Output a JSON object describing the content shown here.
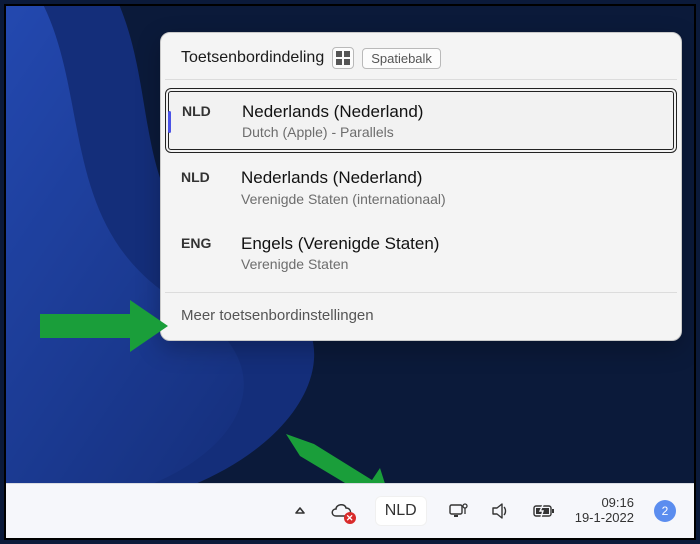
{
  "flyout": {
    "title": "Toetsenbordindeling",
    "shortcut_keys": {
      "win": "⊞",
      "spatie": "Spatiebalk"
    },
    "items": [
      {
        "code": "NLD",
        "lang": "Nederlands (Nederland)",
        "sub": "Dutch (Apple) - Parallels",
        "selected": true
      },
      {
        "code": "NLD",
        "lang": "Nederlands (Nederland)",
        "sub": "Verenigde Staten (internationaal)",
        "selected": false
      },
      {
        "code": "ENG",
        "lang": "Engels (Verenigde Staten)",
        "sub": "Verenigde Staten",
        "selected": false
      }
    ],
    "more": "Meer toetsenbordinstellingen"
  },
  "taskbar": {
    "lang": "NLD",
    "time": "09:16",
    "date": "19-1-2022",
    "notif_count": "2"
  },
  "colors": {
    "accent": "#4b53e6",
    "arrow": "#1a9e3a",
    "badge": "#5b8def",
    "error": "#d92b2b"
  }
}
